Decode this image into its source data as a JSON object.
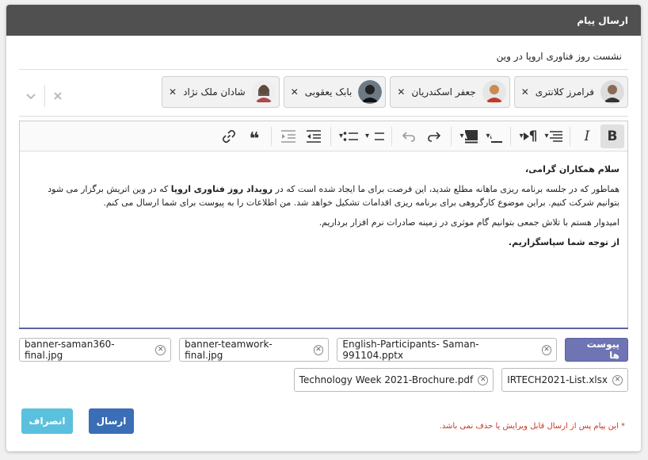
{
  "header": {
    "title": "ارسال پیام"
  },
  "subject": {
    "value": "نشست روز فناوری اروپا در وین"
  },
  "recipients": [
    {
      "name": "فرامرز کلانتری",
      "avatar_color": "#8a6b55"
    },
    {
      "name": "جعفر اسکندریان",
      "avatar_color": "#c98a54"
    },
    {
      "name": "بابک یعقوبی",
      "avatar_color": "#6b7a85"
    },
    {
      "name": "شادان ملک نژاد",
      "avatar_color": "#b0474f"
    }
  ],
  "recipient_controls": {
    "clear_icon": "×",
    "dropdown_icon": "⌄"
  },
  "toolbar": {
    "bold": "B",
    "italic": "I",
    "icons": [
      "bold-icon",
      "italic-icon",
      "align-icon",
      "paragraph-direction-icon",
      "font-color-icon",
      "background-color-icon",
      "redo-icon",
      "undo-icon",
      "numbered-list-icon",
      "bulleted-list-icon",
      "outdent-icon",
      "indent-icon",
      "blockquote-icon",
      "link-icon"
    ]
  },
  "content": {
    "greeting": "سلام همکاران گرامی،",
    "p1_part1": "هماطور که در جلسه برنامه ریزی ماهانه مطلع شدید، این فرصت برای ما ایجاد شده است که در ",
    "p1_bold": "رویداد روز فناوری اروپا",
    "p1_part2": " که در وین اتریش برگزار می شود بتوانیم شرکت کنیم. براین موضوع کارگروهی برای برنامه ریزی اقدامات تشکیل خواهد شد. من اطلاعات را به پیوست برای شما ارسال می کنم.",
    "p2": "امیدوار هستم با تلاش جمعی بتوانیم گام موثری در زمینه صادرات نرم افزار برداریم.",
    "closing": "از توجه شما سپاسگزاریم."
  },
  "attachments": {
    "button_label": "پیوست ها",
    "files": [
      "English-Participants- Saman-991104.pptx",
      "banner-teamwork-final.jpg",
      "banner-saman360-final.jpg",
      "IRTECH2021-List.xlsx",
      "Technology Week 2021-Brochure.pdf"
    ]
  },
  "footer": {
    "note": "* این پیام پس از ارسال قابل ویرایش یا حذف نمی باشد.",
    "send_label": "ارسال",
    "cancel_label": "انصراف"
  },
  "colors": {
    "header": "#505050",
    "send": "#3a6eb6",
    "cancel": "#5bc0de",
    "attach": "#6f74b4",
    "note": "#c0392b"
  }
}
